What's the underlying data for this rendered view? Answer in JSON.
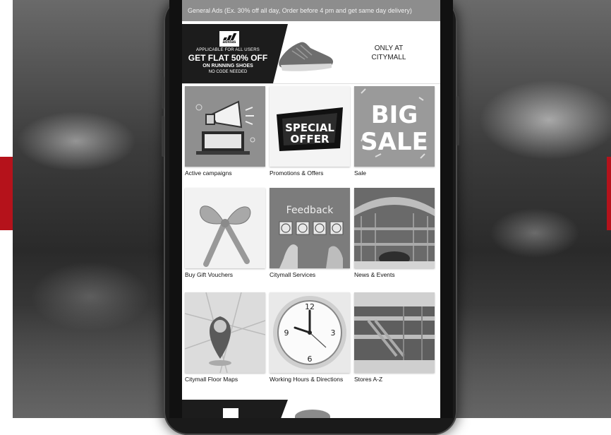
{
  "top_ad": {
    "text": "General Ads (Ex. 30% off all day, Order before 4 pm and get same day delivery)"
  },
  "banner": {
    "logo_word": "adidas",
    "line1": "APPLICABLE FOR ALL USERS",
    "line2": "GET FLAT 50% OFF",
    "line3": "ON RUNNING SHOES",
    "line4": "NO CODE NEEDED",
    "right_line1": "ONLY AT",
    "right_line2": "CITYMALL"
  },
  "tiles": [
    {
      "label": "Active campaigns",
      "icon": "megaphone-laptop-icon"
    },
    {
      "label": "Promotions & Offers",
      "icon": "special-offer-icon",
      "art_line1": "SPECIAL",
      "art_line2": "OFFER"
    },
    {
      "label": "Sale",
      "icon": "big-sale-icon",
      "art_line1": "BIG",
      "art_line2": "SALE"
    },
    {
      "label": "Buy Gift Vouchers",
      "icon": "ribbon-bow-icon"
    },
    {
      "label": "Citymall Services",
      "icon": "feedback-faces-icon",
      "art_text": "Feedback"
    },
    {
      "label": "News & Events",
      "icon": "mall-atrium-icon"
    },
    {
      "label": "Citymall Floor Maps",
      "icon": "map-pin-icon"
    },
    {
      "label": "Working Hours & Directions",
      "icon": "wall-clock-icon"
    },
    {
      "label": "Stores A-Z",
      "icon": "mall-stores-icon"
    }
  ],
  "colors": {
    "accent_red": "#b5121b",
    "ad_strip": "#8d8d8d",
    "banner_dark": "#1c1c1c"
  }
}
